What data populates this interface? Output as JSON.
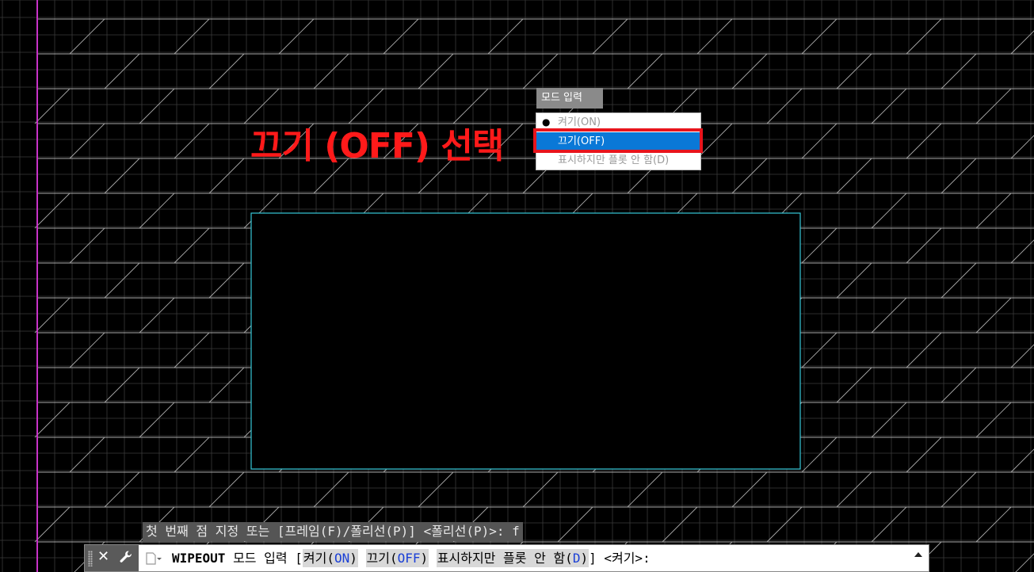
{
  "annotation": {
    "text": "끄기 (OFF) 선택"
  },
  "popup": {
    "title": "모드 입력",
    "items": [
      {
        "label": "켜기(ON)",
        "bullet": "●"
      },
      {
        "label": "끄기(OFF)",
        "bullet": ""
      },
      {
        "label": "표시하지만 플롯 안 함(D)",
        "bullet": ""
      }
    ],
    "selected_index": 1
  },
  "command_history": {
    "text": "첫 번째 점 지정 또는 [프레임(F)/폴리선(P)] <폴리선(P)>: f"
  },
  "command_line": {
    "command": "WIPEOUT",
    "prompt": " 모드 입력 [",
    "options": [
      {
        "label": "켜기",
        "key": "ON"
      },
      {
        "label": "끄기",
        "key": "OFF"
      },
      {
        "label": "표시하지만 플롯 안 함",
        "key": "D"
      }
    ],
    "suffix": "] <켜기>:"
  },
  "colors": {
    "background": "#000000",
    "grid": "#3a3a3a",
    "hatch": "#a8a8a8",
    "magenta_axis": "#c832c8",
    "wipeout_frame": "#35c8d8",
    "highlight": "#e8141c",
    "selection": "#0a78d7"
  },
  "icons": {
    "close": "close-icon",
    "customize": "wrench-icon",
    "recent": "recent-commands-icon",
    "history": "chevron-up-icon"
  }
}
